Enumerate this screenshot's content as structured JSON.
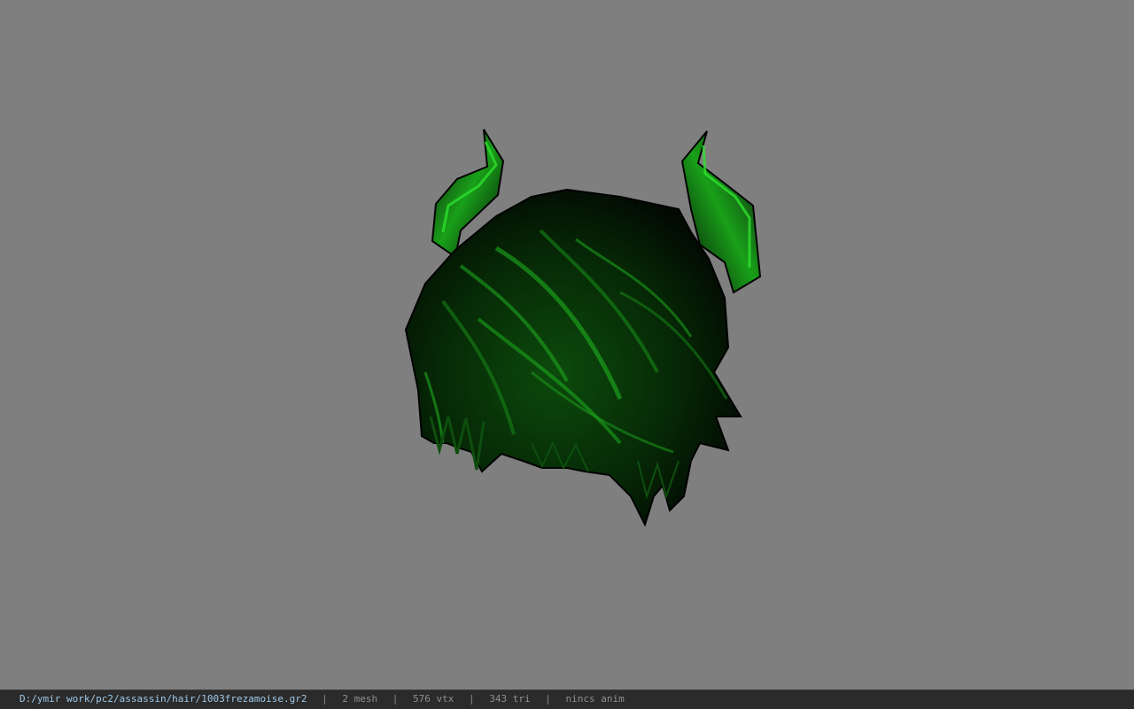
{
  "viewport": {
    "background_color": "#7f7f7f",
    "model": {
      "icon": "horned-hair-mesh",
      "primary_color": "#0a3a0a",
      "highlight_color": "#22c822"
    }
  },
  "status_bar": {
    "file_path": "D:/ymir work/pc2/assassin/hair/1003frezamoise.gr2",
    "mesh_count": "2 mesh",
    "vertex_count": "576 vtx",
    "triangle_count": "343 tri",
    "anim_info": "nincs anim",
    "separator": "|"
  }
}
